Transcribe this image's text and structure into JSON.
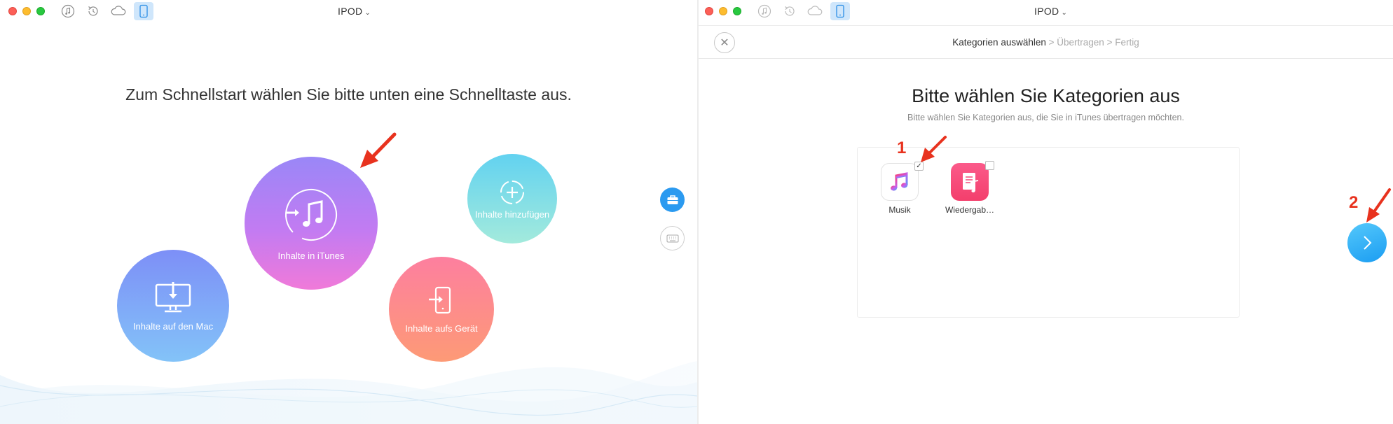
{
  "left": {
    "device_name": "IPOD",
    "headline": "Zum Schnellstart wählen Sie bitte unten eine Schnelltaste aus.",
    "buttons": {
      "itunes": "Inhalte in iTunes",
      "mac": "Inhalte auf den Mac",
      "add": "Inhalte hinzufügen",
      "device": "Inhalte aufs Gerät"
    },
    "toolbar_icons": [
      "music-icon",
      "restore-icon",
      "cloud-icon",
      "device-icon"
    ]
  },
  "right": {
    "device_name": "IPOD",
    "breadcrumb": {
      "step1": "Kategorien auswählen",
      "sep1": " > ",
      "step2": "Übertragen",
      "sep2": " > ",
      "step3": "Fertig"
    },
    "title": "Bitte wählen Sie Kategorien aus",
    "subtitle": "Bitte wählen Sie Kategorien aus, die Sie in iTunes übertragen möchten.",
    "categories": [
      {
        "label": "Musik",
        "checked": true
      },
      {
        "label": "Wiedergab…",
        "checked": false
      }
    ],
    "annotations": {
      "one": "1",
      "two": "2"
    }
  },
  "colors": {
    "accent_blue": "#1b9df2",
    "annotation_red": "#e8321e"
  }
}
